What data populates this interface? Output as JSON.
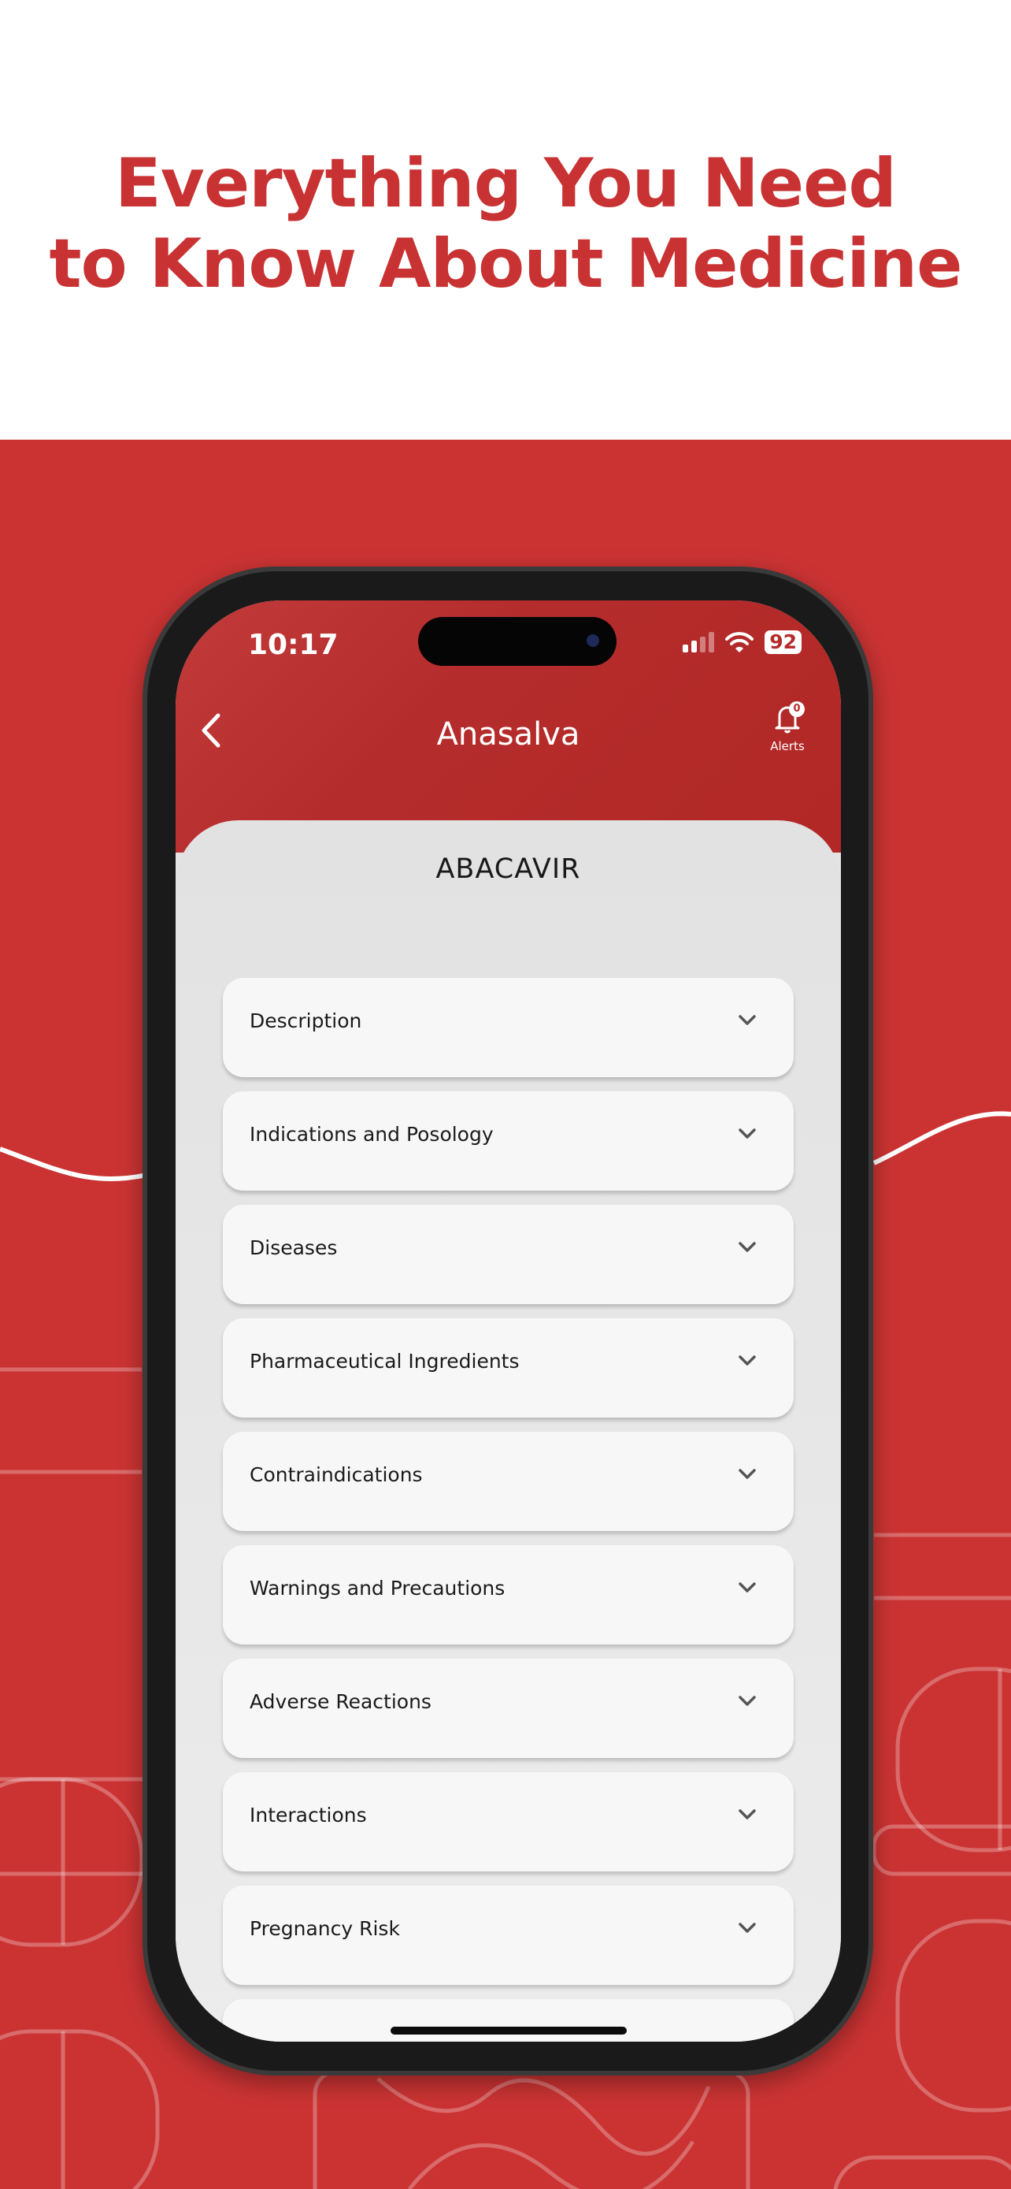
{
  "headline": {
    "line1": "Everything You Need",
    "line2": "to Know About Medicine"
  },
  "colors": {
    "brand_red": "#cb3333",
    "headline_red": "#c93233",
    "card_bg": "#f7f7f7"
  },
  "status_bar": {
    "time": "10:17",
    "battery": "92",
    "icons": [
      "signal-icon",
      "wifi-icon",
      "battery-icon"
    ]
  },
  "nav": {
    "back_icon": "chevron-left-icon",
    "title": "Anasalva",
    "alerts_label": "Alerts",
    "alerts_count": "0",
    "alerts_icon": "bell-icon"
  },
  "drug_name": "ABACAVIR",
  "sections": [
    {
      "label": "Description"
    },
    {
      "label": "Indications and Posology"
    },
    {
      "label": "Diseases"
    },
    {
      "label": "Pharmaceutical Ingredients"
    },
    {
      "label": "Contraindications"
    },
    {
      "label": "Warnings and Precautions"
    },
    {
      "label": "Adverse Reactions"
    },
    {
      "label": "Interactions"
    },
    {
      "label": "Pregnancy Risk"
    },
    {
      "label": ""
    }
  ]
}
